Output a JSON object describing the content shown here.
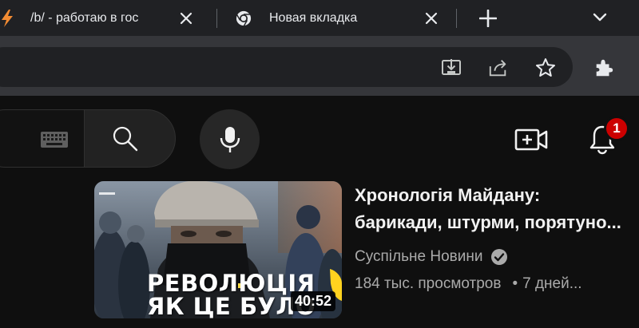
{
  "browser": {
    "tabs": [
      {
        "title": "/b/ - работаю в гос",
        "icon": "lightning-icon",
        "active": false
      },
      {
        "title": "Новая вкладка",
        "icon": "chrome-icon",
        "active": false
      }
    ],
    "toolbar_icons": [
      "install-app-icon",
      "share-icon",
      "bookmark-star-icon",
      "extensions-icon"
    ],
    "colors": {
      "tabstrip": "#202124",
      "toolbar": "#35363a",
      "tab_text": "#e8eaed",
      "favicon_accent": "#f28b32"
    }
  },
  "youtube": {
    "header_icons": [
      "keyboard-icon",
      "search-icon",
      "microphone-icon",
      "create-video-icon",
      "notifications-bell-icon"
    ],
    "notification_count": "1",
    "colors": {
      "background": "#0f0f0f",
      "badge": "#cc0000",
      "secondary_text": "#aaaaaa"
    }
  },
  "video": {
    "thumbnail_text_line1": "РЕВОЛЮЦІЯ",
    "thumbnail_text_line2": "ЯК ЦЕ БУЛО",
    "duration": "40:52",
    "title": "Хронологія Майдану: барикади, штурми, порятуно...",
    "title_line1": "Хронологія Майдану:",
    "title_line2": "барикади, штурми, порятуно...",
    "channel": "Суспільне Новини",
    "views": "184 тыс. просмотров",
    "age": "7 дней...",
    "separator": "•"
  }
}
